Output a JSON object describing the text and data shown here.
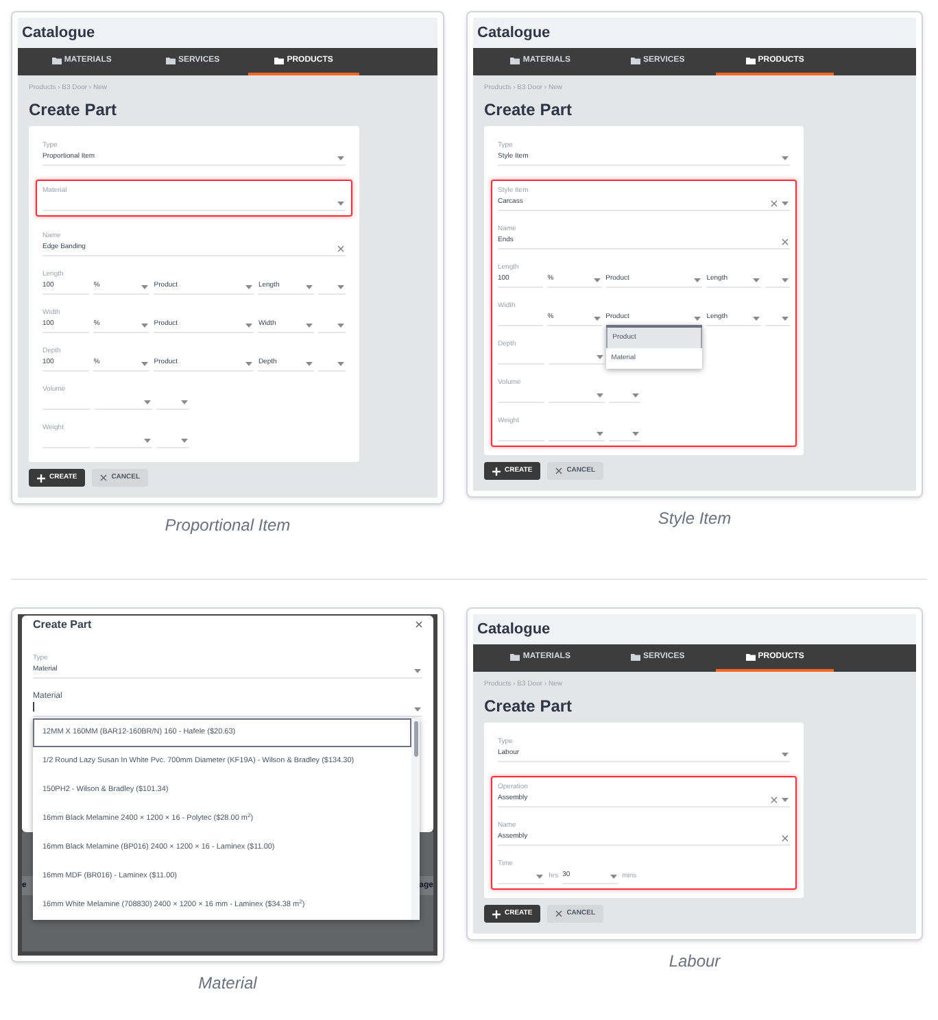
{
  "figures": [
    {
      "kind": "page",
      "caption": "Proportional Item",
      "app_title": "Catalogue",
      "tabs": [
        {
          "label": "MATERIALS",
          "selected": false
        },
        {
          "label": "SERVICES",
          "selected": false
        },
        {
          "label": "PRODUCTS",
          "selected": true
        }
      ],
      "breadcrumb": "Products › B3 Door › New",
      "heading": "Create Part",
      "sections": [
        {
          "highlighted": false,
          "fields": [
            {
              "label": "Type",
              "controls": [
                {
                  "kind": "select",
                  "value": "Proportional Item"
                }
              ]
            }
          ]
        },
        {
          "highlighted": true,
          "fields": [
            {
              "label": "Material",
              "controls": [
                {
                  "kind": "select"
                }
              ]
            }
          ]
        },
        {
          "highlighted": false,
          "fields": [
            {
              "label": "Name",
              "controls": [
                {
                  "kind": "input",
                  "value": "Edge Banding",
                  "clearable": true
                }
              ]
            },
            {
              "label": "Length",
              "controls": [
                {
                  "kind": "input",
                  "value": "100"
                },
                {
                  "kind": "select",
                  "value": "%"
                },
                {
                  "kind": "select",
                  "value": "Product"
                },
                {
                  "kind": "select",
                  "value": "Length"
                },
                {
                  "kind": "select"
                }
              ]
            },
            {
              "label": "Width",
              "controls": [
                {
                  "kind": "input",
                  "value": "100"
                },
                {
                  "kind": "select",
                  "value": "%"
                },
                {
                  "kind": "select",
                  "value": "Product"
                },
                {
                  "kind": "select",
                  "value": "Width"
                },
                {
                  "kind": "select"
                }
              ]
            },
            {
              "label": "Depth",
              "controls": [
                {
                  "kind": "input",
                  "value": "100"
                },
                {
                  "kind": "select",
                  "value": "%"
                },
                {
                  "kind": "select",
                  "value": "Product"
                },
                {
                  "kind": "select",
                  "value": "Depth"
                },
                {
                  "kind": "select"
                }
              ]
            },
            {
              "label": "Volume",
              "controls": [
                {
                  "kind": "input"
                },
                {
                  "kind": "select"
                },
                {
                  "kind": "select"
                }
              ]
            },
            {
              "label": "Weight",
              "controls": [
                {
                  "kind": "input"
                },
                {
                  "kind": "select"
                },
                {
                  "kind": "select"
                }
              ]
            }
          ]
        }
      ],
      "buttons": [
        {
          "kind": "create",
          "label": "CREATE"
        },
        {
          "kind": "cancel",
          "label": "CANCEL"
        }
      ]
    },
    {
      "kind": "page",
      "caption": "Style Item",
      "app_title": "Catalogue",
      "tabs": [
        {
          "label": "MATERIALS",
          "selected": false
        },
        {
          "label": "SERVICES",
          "selected": false
        },
        {
          "label": "PRODUCTS",
          "selected": true
        }
      ],
      "breadcrumb": "Products › B3 Door › New",
      "heading": "Create Part",
      "sections": [
        {
          "highlighted": false,
          "fields": [
            {
              "label": "Type",
              "controls": [
                {
                  "kind": "select",
                  "value": "Style Item"
                }
              ]
            }
          ]
        },
        {
          "highlighted": true,
          "fields": [
            {
              "label": "Style Item",
              "controls": [
                {
                  "kind": "select",
                  "value": "Carcass",
                  "clearable": true
                }
              ]
            },
            {
              "label": "Name",
              "controls": [
                {
                  "kind": "input",
                  "value": "Ends",
                  "clearable": true
                }
              ]
            },
            {
              "label": "Length",
              "controls": [
                {
                  "kind": "input",
                  "value": "100"
                },
                {
                  "kind": "select",
                  "value": "%"
                },
                {
                  "kind": "select",
                  "value": "Product"
                },
                {
                  "kind": "select",
                  "value": "Length"
                },
                {
                  "kind": "select"
                }
              ]
            },
            {
              "label": "Width",
              "controls": [
                {
                  "kind": "input"
                },
                {
                  "kind": "select",
                  "value": "%"
                },
                {
                  "kind": "select",
                  "value": "Product",
                  "menu": [
                    {
                      "label": "Product",
                      "selected": true
                    },
                    {
                      "label": "Material",
                      "selected": false
                    }
                  ]
                },
                {
                  "kind": "select",
                  "value": "Length"
                },
                {
                  "kind": "select"
                }
              ]
            },
            {
              "label": "Depth",
              "controls": [
                {
                  "kind": "input"
                },
                {
                  "kind": "select"
                }
              ]
            },
            {
              "label": "Volume",
              "controls": [
                {
                  "kind": "input"
                },
                {
                  "kind": "select"
                },
                {
                  "kind": "select"
                }
              ]
            },
            {
              "label": "Weight",
              "controls": [
                {
                  "kind": "input"
                },
                {
                  "kind": "select"
                },
                {
                  "kind": "select"
                }
              ]
            }
          ]
        }
      ],
      "buttons": [
        {
          "kind": "create",
          "label": "CREATE"
        },
        {
          "kind": "cancel",
          "label": "CANCEL"
        }
      ]
    },
    {
      "kind": "dialog",
      "caption": "Material",
      "title": "Create Part",
      "fields": [
        {
          "label": "Type",
          "focused": false,
          "controls": [
            {
              "kind": "select",
              "value": "Material"
            }
          ]
        },
        {
          "label": "Material",
          "focused": true,
          "controls": [
            {
              "kind": "select",
              "list": [
                {
                  "label": "12MM X 160MM (BAR12-160BR/N) 160 - Hafele ($20.63)",
                  "selected": true
                },
                {
                  "label": "1/2 Round Lazy Susan In White Pvc. 700mm Diameter (KF19A) - Wilson & Bradley ($134.30)",
                  "selected": false
                },
                {
                  "label": "150PH2 - Wilson & Bradley ($101.34)",
                  "selected": false
                },
                {
                  "label": "16mm Black Melamine 2400 × 1200 × 16 - Polytec ($28.00 m$^{2}$)",
                  "selected": false
                },
                {
                  "label": "16mm Black Melamine (BP016) 2400 × 1200 × 16 - Laminex ($11.00)",
                  "selected": false
                },
                {
                  "label": "16mm MDF (BR016) - Laminex ($11.00)",
                  "selected": false
                },
                {
                  "label": "16mm White Melamine (708830) 2400 × 1200 × 16 mm - Laminex ($34.38 m$^{2}$)",
                  "selected": false
                }
              ]
            }
          ]
        }
      ],
      "background_table": {
        "header_fragments": [
          "e",
          "age"
        ]
      }
    },
    {
      "kind": "page",
      "caption": "Labour",
      "app_title": "Catalogue",
      "tabs": [
        {
          "label": "MATERIALS",
          "selected": false
        },
        {
          "label": "SERVICES",
          "selected": false
        },
        {
          "label": "PRODUCTS",
          "selected": true
        }
      ],
      "breadcrumb": "Products › B3 Door › New",
      "heading": "Create Part",
      "sections": [
        {
          "highlighted": false,
          "fields": [
            {
              "label": "Type",
              "controls": [
                {
                  "kind": "select",
                  "value": "Labour"
                }
              ]
            }
          ]
        },
        {
          "highlighted": true,
          "fields": [
            {
              "label": "Operation",
              "controls": [
                {
                  "kind": "select",
                  "value": "Assembly",
                  "clearable": true
                }
              ]
            },
            {
              "label": "Name",
              "controls": [
                {
                  "kind": "input",
                  "value": "Assembly",
                  "clearable": true
                }
              ]
            },
            {
              "label": "Time",
              "controls": [
                {
                  "kind": "select"
                },
                {
                  "kind": "unit",
                  "value": "hrs"
                },
                {
                  "kind": "select",
                  "value": "30"
                },
                {
                  "kind": "unit",
                  "value": "mins"
                }
              ]
            }
          ]
        }
      ],
      "buttons": [
        {
          "kind": "create",
          "label": "CREATE"
        },
        {
          "kind": "cancel",
          "label": "CANCEL"
        }
      ]
    }
  ]
}
